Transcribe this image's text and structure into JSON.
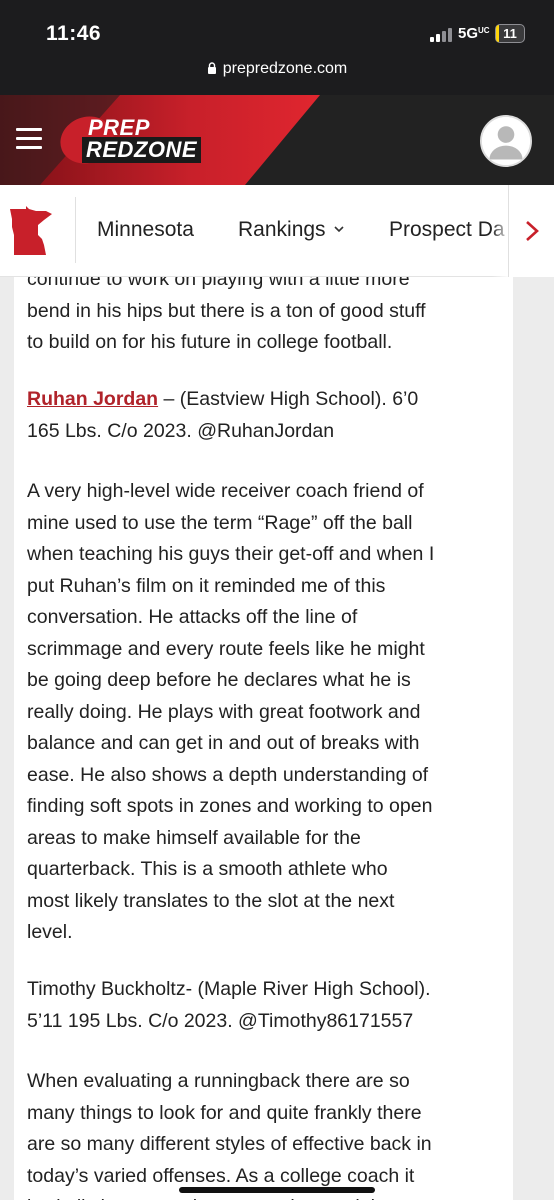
{
  "status_bar": {
    "time": "11:46",
    "network": "5G",
    "network_suffix": "UC",
    "battery": "11",
    "url": "prepredzone.com"
  },
  "header": {
    "logo_line1": "PREP",
    "logo_line2": "REDZONE",
    "accent_color": "#d4202b",
    "background_color": "#222222"
  },
  "nav": {
    "state": "Minnesota",
    "rankings": "Rankings",
    "prospect": "Prospect Da"
  },
  "article": {
    "p1_lines": [
      "continue to work on playing with a little more",
      "bend in his hips but there is a ton of good stuff",
      "to build on for his future in college football."
    ],
    "player1": {
      "name": "Ruhan Jordan",
      "line1_rest": " – (Eastview High School).  6’0",
      "line2": "165 Lbs. C/o 2023.  @RuhanJordan"
    },
    "p2_lines": [
      "A very high-level wide receiver coach friend of",
      "mine used to use the term “Rage” off the ball",
      "when teaching his guys their get-off and when I",
      "put Ruhan’s film on it reminded me of this",
      "conversation.  He attacks off the line of",
      "scrimmage and every route feels like he might",
      "be going deep before he declares what he is",
      "really doing.  He plays with great footwork and",
      "balance and can get in and out of breaks with",
      "ease.  He also shows a depth understanding of",
      "finding soft spots in zones and working to open",
      "areas to make himself available for the",
      "quarterback.  This is a smooth athlete who",
      "most likely translates to the slot at the next",
      "level."
    ],
    "player2_lines": [
      "Timothy Buckholtz- (Maple River High School).",
      "5’11 195 Lbs. C/o 2023.  @Timothy86171557"
    ],
    "p3_lines": [
      "When evaluating a runningback there are so",
      "many things to look for and quite frankly there",
      "are so many different styles of effective back in",
      "today’s varied offenses.  As a college coach it",
      "is vitally important that you understand the"
    ]
  }
}
